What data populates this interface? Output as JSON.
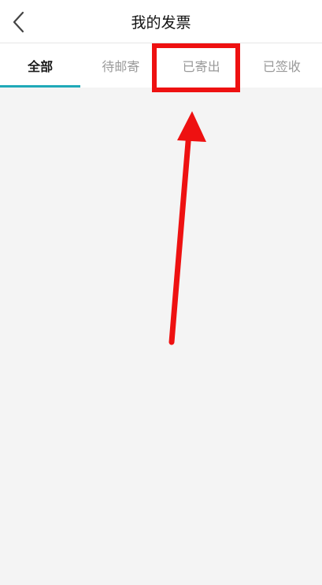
{
  "header": {
    "title": "我的发票",
    "back_icon": "chevron-left-icon"
  },
  "tabs": [
    {
      "label": "全部",
      "active": true
    },
    {
      "label": "待邮寄",
      "active": false
    },
    {
      "label": "已寄出",
      "active": false
    },
    {
      "label": "已签收",
      "active": false
    }
  ],
  "colors": {
    "accent": "#1fa9b8",
    "annotation": "#ee1111",
    "background": "#f4f4f4"
  }
}
